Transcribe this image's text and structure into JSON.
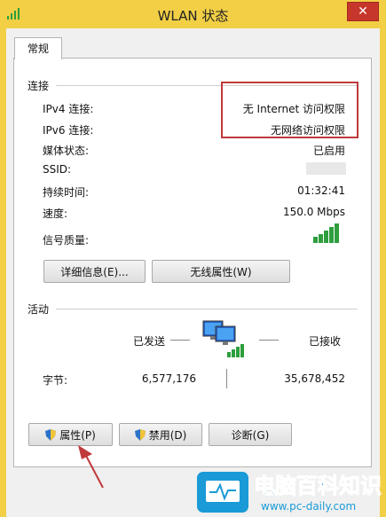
{
  "window": {
    "title": "WLAN 状态",
    "close_glyph": "✕"
  },
  "tab": {
    "label": "常规"
  },
  "connection": {
    "header": "连接",
    "rows": [
      {
        "label": "IPv4 连接:",
        "value": "无 Internet 访问权限"
      },
      {
        "label": "IPv6 连接:",
        "value": "无网络访问权限"
      },
      {
        "label": "媒体状态:",
        "value": "已启用"
      },
      {
        "label": "SSID:",
        "value": ""
      },
      {
        "label": "持续时间:",
        "value": "01:32:41"
      },
      {
        "label": "速度:",
        "value": "150.0 Mbps"
      },
      {
        "label": "信号质量:",
        "value": ""
      }
    ],
    "signal_bars": 5,
    "buttons": {
      "details": "详细信息(E)...",
      "wireless": "无线属性(W)"
    }
  },
  "activity": {
    "header": "活动",
    "sent_label": "已发送",
    "received_label": "已接收",
    "bytes_label": "字节:",
    "bytes_sent": "6,577,176",
    "bytes_received": "35,678,452"
  },
  "bottom_buttons": {
    "properties": "属性(P)",
    "disable": "禁用(D)",
    "diagnose": "诊断(G)"
  },
  "watermark": {
    "cn": "电脑百科知识",
    "url": "www.pc-daily.com"
  },
  "colors": {
    "titlebar": "#f2cf45",
    "highlight": "#c0393b",
    "signal": "#2e9e3e",
    "watermark_blue": "#1a9ad6"
  }
}
